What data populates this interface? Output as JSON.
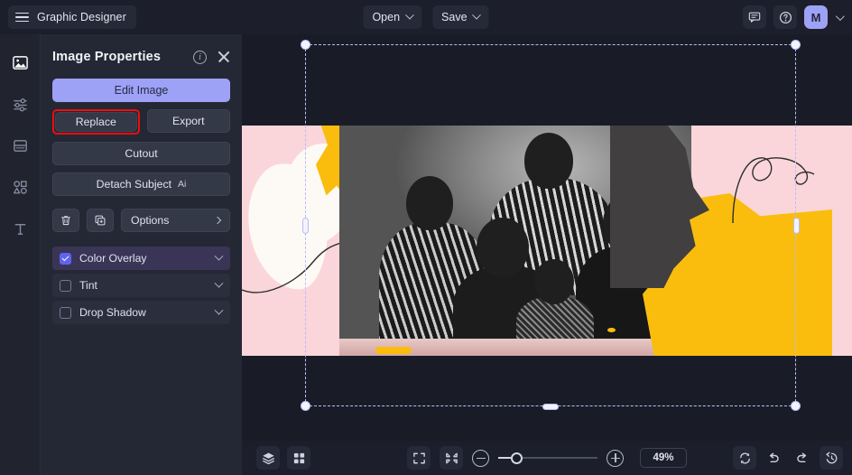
{
  "app": {
    "title": "Graphic Designer",
    "menu_icon": "hamburger-icon"
  },
  "topbar": {
    "open_label": "Open",
    "save_label": "Save",
    "comment_icon": "comment-icon",
    "help_icon": "help-circle-icon",
    "avatar_initial": "M",
    "avatar_color": "#9ea2f6"
  },
  "rail": {
    "items": [
      {
        "name": "image-tool",
        "icon": "image-icon",
        "active": true
      },
      {
        "name": "adjust-tool",
        "icon": "sliders-icon",
        "active": false
      },
      {
        "name": "layout-tool",
        "icon": "layout-icon",
        "active": false
      },
      {
        "name": "shapes-tool",
        "icon": "shapes-icon",
        "active": false
      },
      {
        "name": "text-tool",
        "icon": "text-icon",
        "active": false
      }
    ]
  },
  "panel": {
    "title": "Image Properties",
    "info_icon": "info-icon",
    "close_icon": "close-icon",
    "edit_image_label": "Edit Image",
    "replace_label": "Replace",
    "export_label": "Export",
    "cutout_label": "Cutout",
    "detach_subject_label": "Detach Subject",
    "detach_subject_badge": "Ai",
    "delete_icon": "trash-icon",
    "duplicate_icon": "duplicate-icon",
    "options_label": "Options",
    "options_caret": "chevron-right-icon",
    "highlight_color": "#f40c0c",
    "effects": [
      {
        "label": "Color Overlay",
        "checked": true
      },
      {
        "label": "Tint",
        "checked": false
      },
      {
        "label": "Drop Shadow",
        "checked": false
      }
    ]
  },
  "canvas": {
    "artwork_description": "Grayscale family photo collage with pink, white and yellow paint-stroke overlays",
    "colors": {
      "pink": "#fad6da",
      "yellow": "#fabd0e",
      "cream": "#fdfaf6",
      "canvas_background": "#191c27",
      "selection": "#b9bdf5"
    },
    "selection_active": true
  },
  "bottombar": {
    "layers_icon": "layers-icon",
    "grid_icon": "grid-icon",
    "fit_screen_icon": "fit-screen-icon",
    "shrink_icon": "collapse-icon",
    "zoom_out_icon": "zoom-out-icon",
    "zoom_in_icon": "zoom-in-icon",
    "zoom_level": "49%",
    "refresh_icon": "sync-icon",
    "undo_icon": "undo-icon",
    "redo_icon": "redo-icon",
    "history_icon": "history-icon"
  }
}
